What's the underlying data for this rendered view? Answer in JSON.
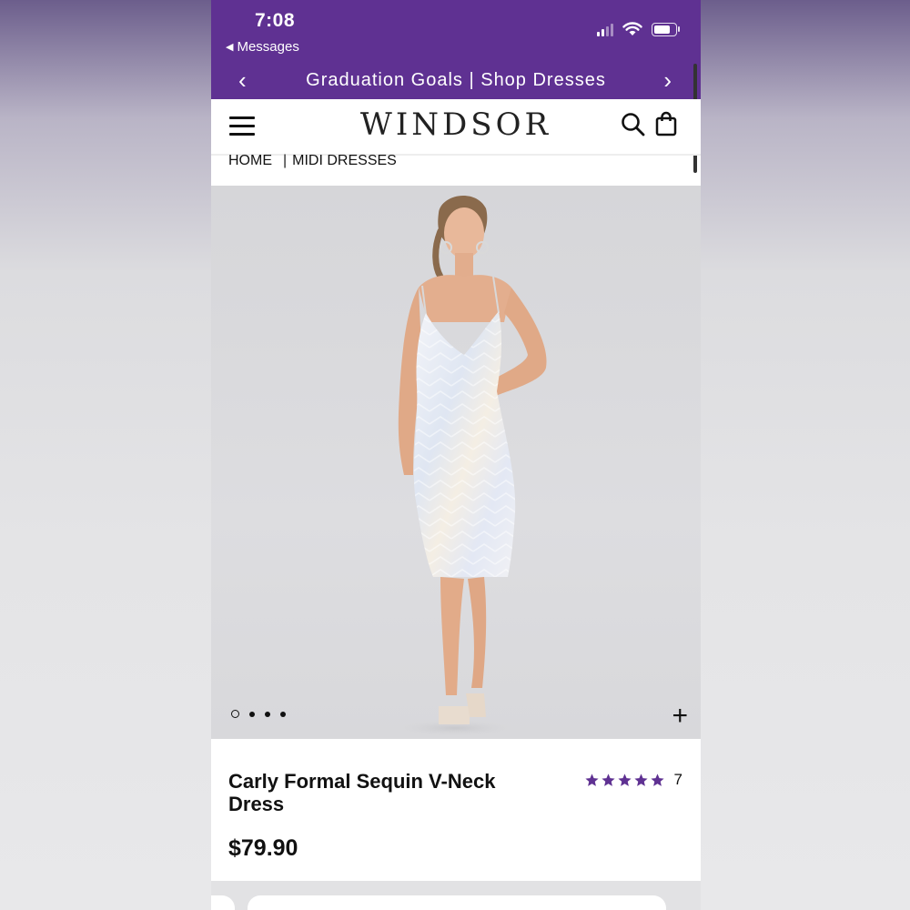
{
  "status_bar": {
    "time": "7:08",
    "back_label": "Messages",
    "icons": [
      "cellular-signal-icon",
      "wifi-icon",
      "battery-icon"
    ]
  },
  "promo_banner": {
    "text": "Graduation Goals | Shop Dresses",
    "background_color": "#5f3192"
  },
  "header": {
    "logo": "WINDSOR",
    "icons": [
      "menu-icon",
      "search-icon",
      "shopping-bag-icon"
    ]
  },
  "breadcrumb": {
    "items": [
      "HOME",
      "MIDI DRESSES"
    ],
    "separator": "|"
  },
  "gallery": {
    "image_alt": "Model wearing iridescent sequin v-neck midi dress",
    "slide_count": 4,
    "active_slide": 1,
    "zoom_label": "+"
  },
  "product": {
    "title": "Carly Formal Sequin V-Neck Dress",
    "price": "$79.90",
    "rating_stars": 5,
    "review_count": "7",
    "star_color": "#5f3192"
  }
}
